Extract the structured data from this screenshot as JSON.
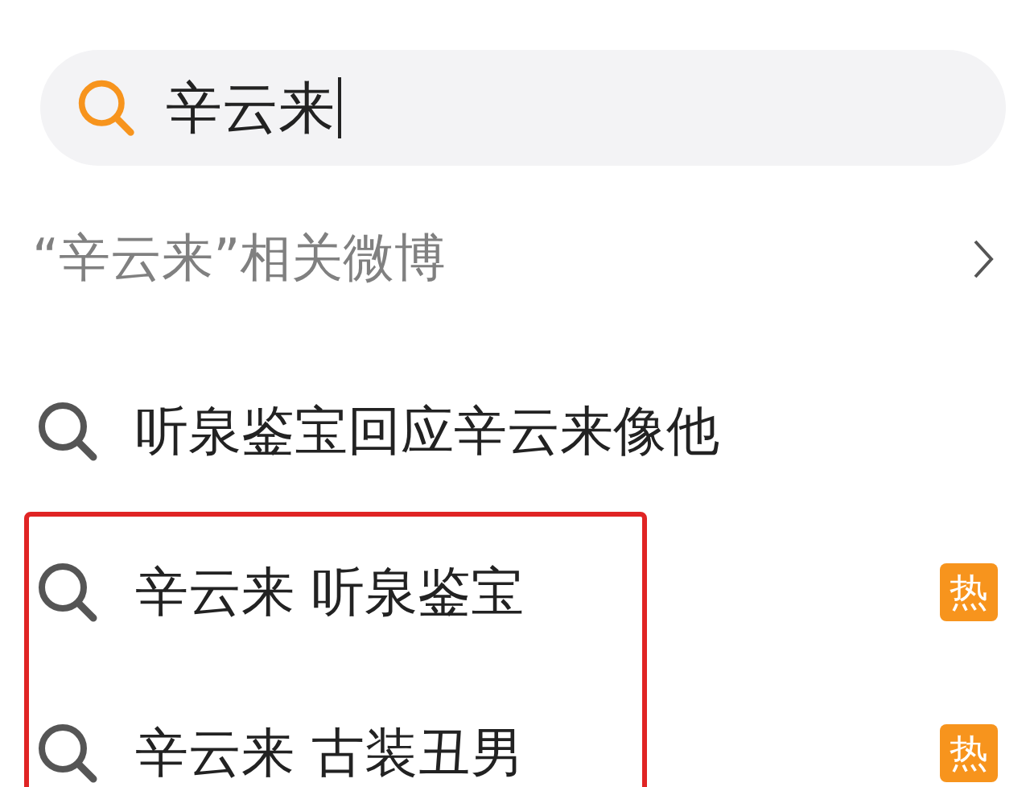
{
  "search": {
    "value": "辛云来"
  },
  "related": {
    "label": "“辛云来”相关微博"
  },
  "suggestions": [
    {
      "text": "听泉鉴宝回应辛云来像他",
      "highlighted": false
    },
    {
      "text": "辛云来 听泉鉴宝",
      "badge": "热",
      "highlighted": true
    },
    {
      "text": "辛云来 古装丑男",
      "badge": "热",
      "highlighted": true
    }
  ]
}
